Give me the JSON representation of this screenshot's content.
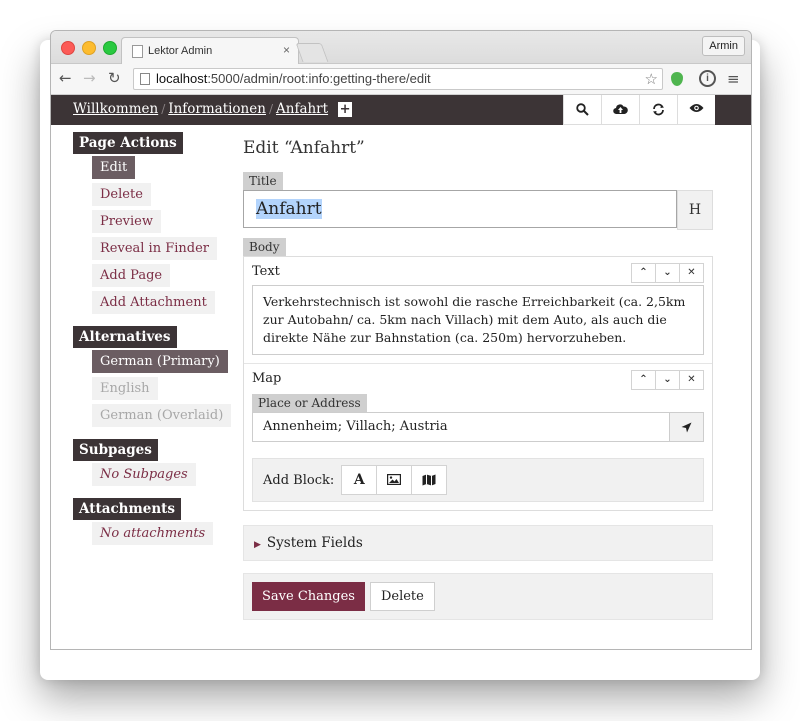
{
  "browser": {
    "tab_title": "Lektor Admin",
    "tab_close": "×",
    "user": "Armin",
    "url_host": "localhost",
    "url_path": ":5000/admin/root:info:getting-there/edit",
    "back_glyph": "←",
    "forward_glyph": "→",
    "reload_glyph": "↻",
    "star_glyph": "☆",
    "info_glyph": "i",
    "menu_glyph": "≡"
  },
  "header": {
    "breadcrumbs": [
      "Willkommen",
      "Informationen",
      "Anfahrt"
    ],
    "separator": "/",
    "add_glyph": "+",
    "icons": [
      "search-icon",
      "cloud-upload-icon",
      "refresh-icon",
      "eye-icon"
    ]
  },
  "sidebar": {
    "page_actions_title": "Page Actions",
    "page_actions": [
      "Edit",
      "Delete",
      "Preview",
      "Reveal in Finder",
      "Add Page",
      "Add Attachment"
    ],
    "alternatives_title": "Alternatives",
    "alternatives": [
      "German (Primary)",
      "English",
      "German (Overlaid)"
    ],
    "subpages_title": "Subpages",
    "subpages_empty": "No Subpages",
    "attachments_title": "Attachments",
    "attachments_empty": "No attachments"
  },
  "main": {
    "heading": "Edit “Anfahrt”",
    "title_label": "Title",
    "title_value": "Anfahrt",
    "h_button": "H",
    "body_label": "Body",
    "text_block": {
      "name": "Text",
      "content": "Verkehrstechnisch ist sowohl die rasche Erreichbarkeit (ca. 2,5km zur Autobahn/ ca. 5km nach Villach) mit dem Auto, als auch die direkte Nähe zur Bahnstation (ca. 250m) hervorzuheben."
    },
    "map_block": {
      "name": "Map",
      "address_label": "Place or Address",
      "address_value": "Annenheim; Villach; Austria"
    },
    "block_controls": [
      "up",
      "down",
      "remove"
    ],
    "add_block_label": "Add Block:",
    "add_block_buttons": [
      "text-icon",
      "image-icon",
      "map-icon"
    ],
    "system_fields": "System Fields",
    "save_button": "Save Changes",
    "delete_button": "Delete"
  },
  "colors": {
    "accent": "#7b2d45",
    "header_bg": "#3c3436",
    "active_item": "#6b5d62"
  }
}
